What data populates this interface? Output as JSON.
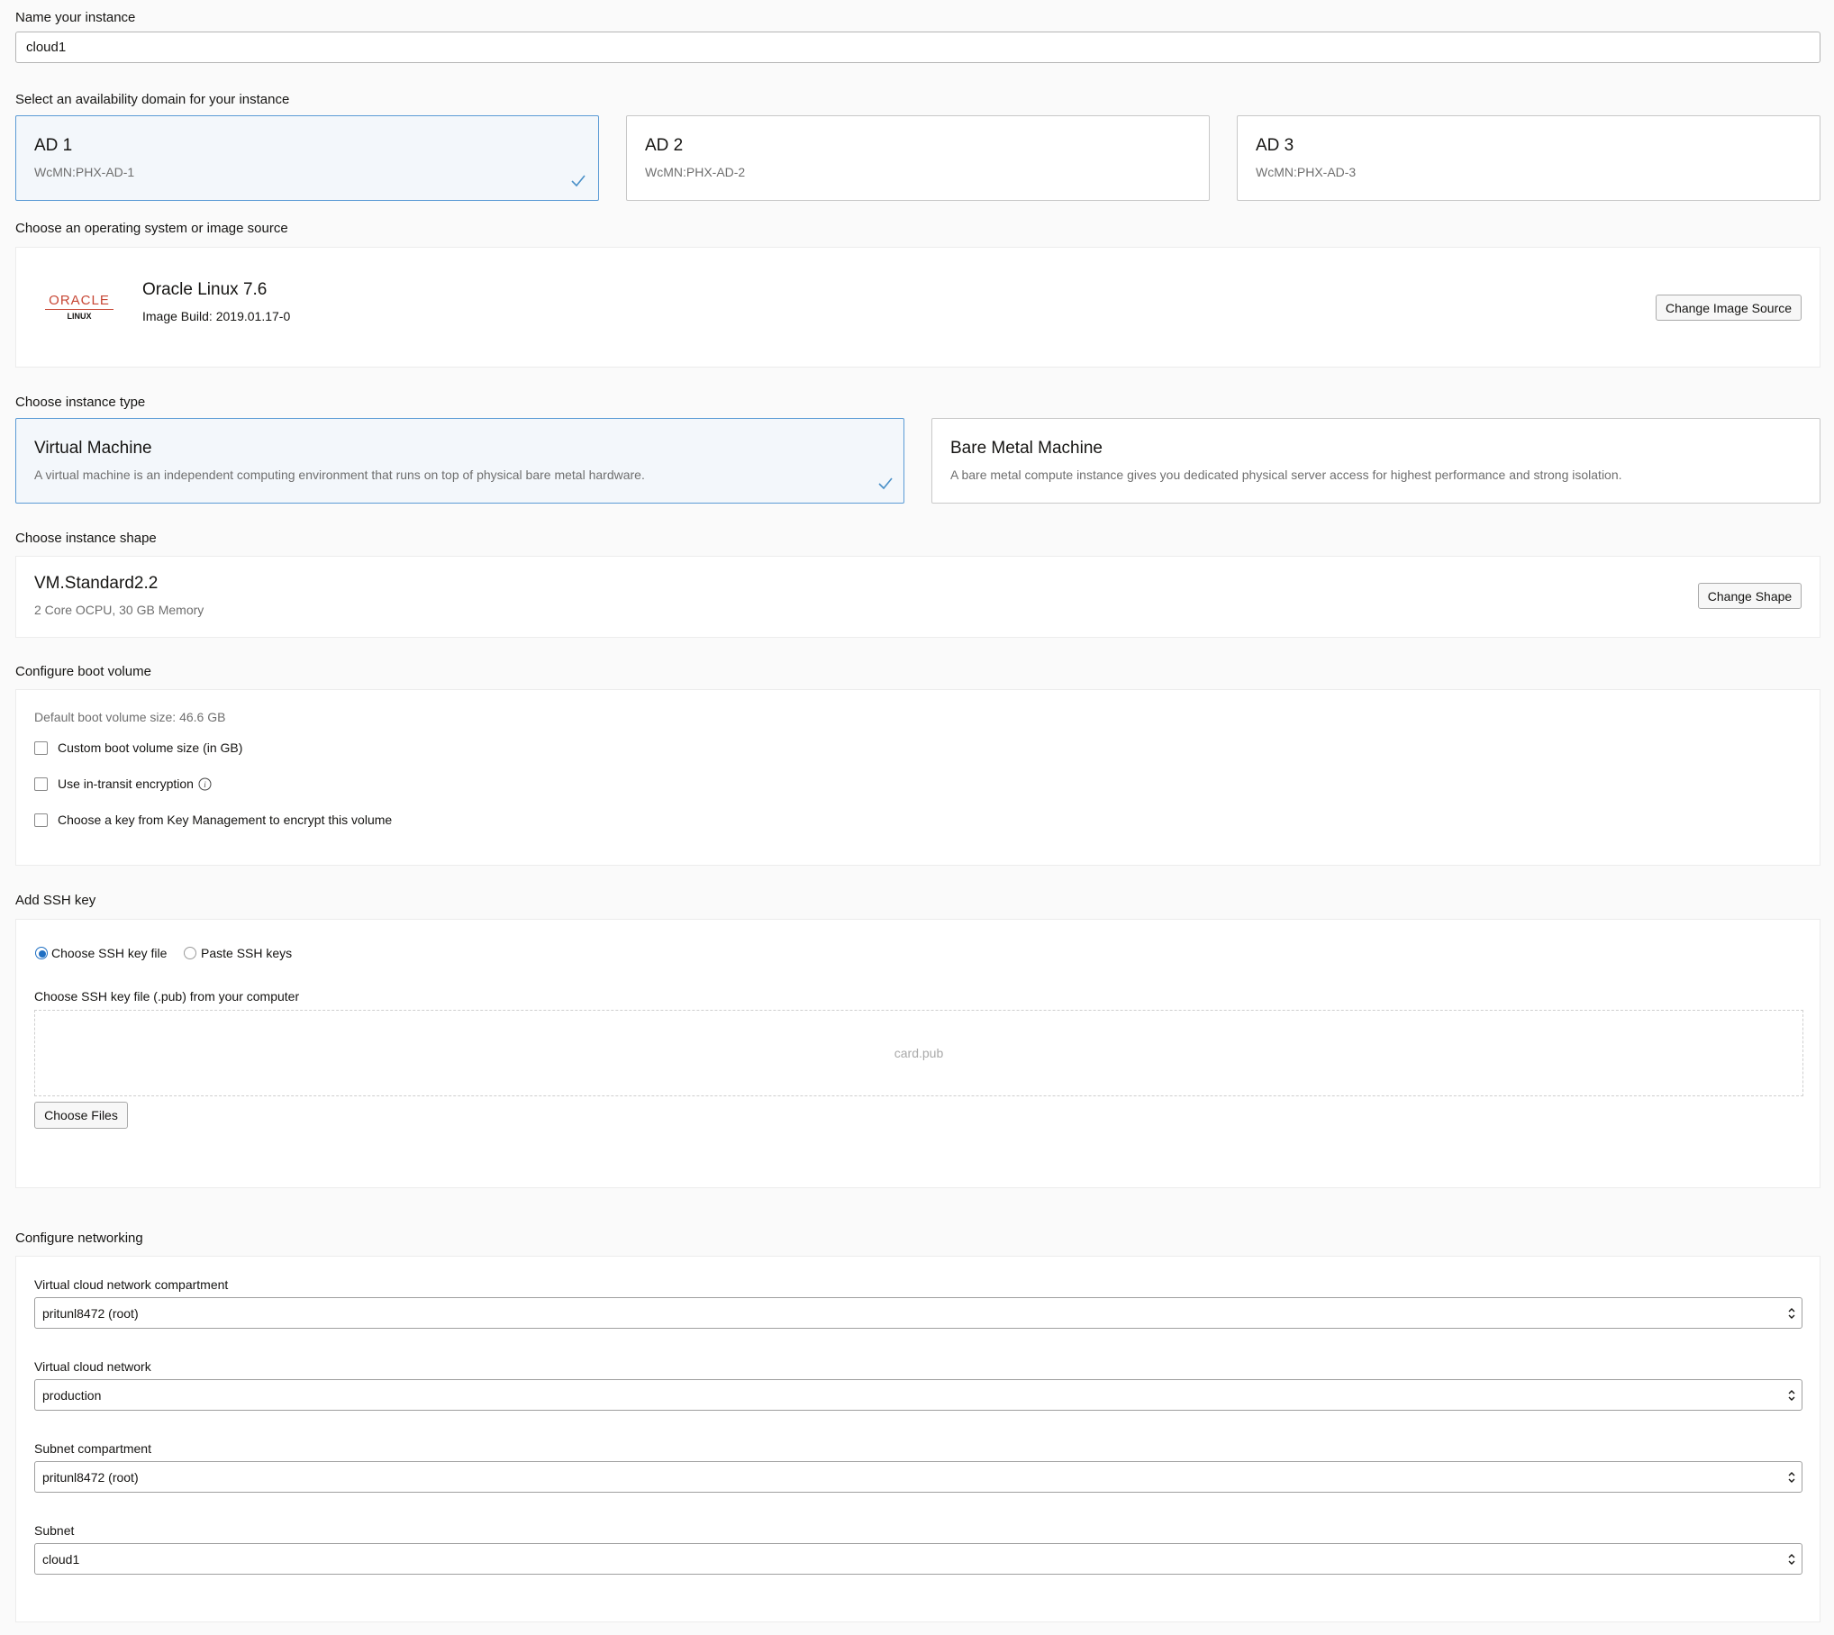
{
  "name_section": {
    "label": "Name your instance",
    "value": "cloud1"
  },
  "availability_domain": {
    "label": "Select an availability domain for your instance",
    "options": [
      {
        "title": "AD 1",
        "subtitle": "WcMN:PHX-AD-1",
        "selected": true
      },
      {
        "title": "AD 2",
        "subtitle": "WcMN:PHX-AD-2",
        "selected": false
      },
      {
        "title": "AD 3",
        "subtitle": "WcMN:PHX-AD-3",
        "selected": false
      }
    ]
  },
  "image_source": {
    "label": "Choose an operating system or image source",
    "logo_text": "ORACLE",
    "logo_subtext": "LINUX",
    "name": "Oracle Linux 7.6",
    "build": "Image Build: 2019.01.17-0",
    "change_button": "Change Image Source"
  },
  "instance_type": {
    "label": "Choose instance type",
    "options": [
      {
        "title": "Virtual Machine",
        "description": "A virtual machine is an independent computing environment that runs on top of physical bare metal hardware.",
        "selected": true
      },
      {
        "title": "Bare Metal Machine",
        "description": "A bare metal compute instance gives you dedicated physical server access for highest performance and strong isolation.",
        "selected": false
      }
    ]
  },
  "instance_shape": {
    "label": "Choose instance shape",
    "name": "VM.Standard2.2",
    "details": "2 Core OCPU, 30 GB Memory",
    "change_button": "Change Shape"
  },
  "boot_volume": {
    "label": "Configure boot volume",
    "default_size": "Default boot volume size: 46.6 GB",
    "options": [
      {
        "label": "Custom boot volume size (in GB)",
        "checked": false
      },
      {
        "label": "Use in-transit encryption",
        "checked": false,
        "info_icon": "info-icon"
      },
      {
        "label": "Choose a key from Key Management to encrypt this volume",
        "checked": false
      }
    ]
  },
  "ssh_key": {
    "label": "Add SSH key",
    "radio_options": [
      {
        "label": "Choose SSH key file",
        "selected": true
      },
      {
        "label": "Paste SSH keys",
        "selected": false
      }
    ],
    "file_label": "Choose SSH key file (.pub) from your computer",
    "dropzone_file": "card.pub",
    "choose_button": "Choose Files"
  },
  "networking": {
    "label": "Configure networking",
    "fields": [
      {
        "label": "Virtual cloud network compartment",
        "value": "pritunl8472 (root)"
      },
      {
        "label": "Virtual cloud network",
        "value": "production"
      },
      {
        "label": "Subnet compartment",
        "value": "pritunl8472 (root)"
      },
      {
        "label": "Subnet",
        "value": "cloud1"
      }
    ]
  },
  "colors": {
    "accent": "#1f6fc3",
    "selected_border": "#5b9bd5",
    "selected_bg": "#f3f7fb",
    "oracle_red": "#c74634"
  }
}
